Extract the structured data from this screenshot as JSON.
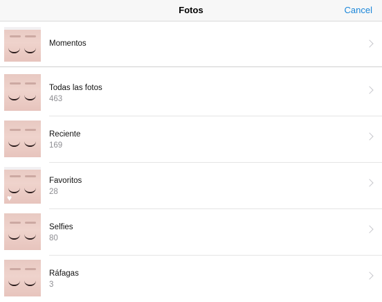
{
  "navbar": {
    "title": "Fotos",
    "cancel_label": "Cancel"
  },
  "albums": [
    {
      "label": "Momentos",
      "count": null
    },
    {
      "label": "Todas las fotos",
      "count": "463"
    },
    {
      "label": "Reciente",
      "count": "169"
    },
    {
      "label": "Favoritos",
      "count": "28"
    },
    {
      "label": "Selfies",
      "count": "80"
    },
    {
      "label": "Ráfagas",
      "count": "3"
    }
  ],
  "icons": {
    "chevron": "chevron-right-icon",
    "favorite": "heart-icon"
  },
  "colors": {
    "accent": "#1a86d9",
    "secondary_text": "#8e8e93"
  }
}
